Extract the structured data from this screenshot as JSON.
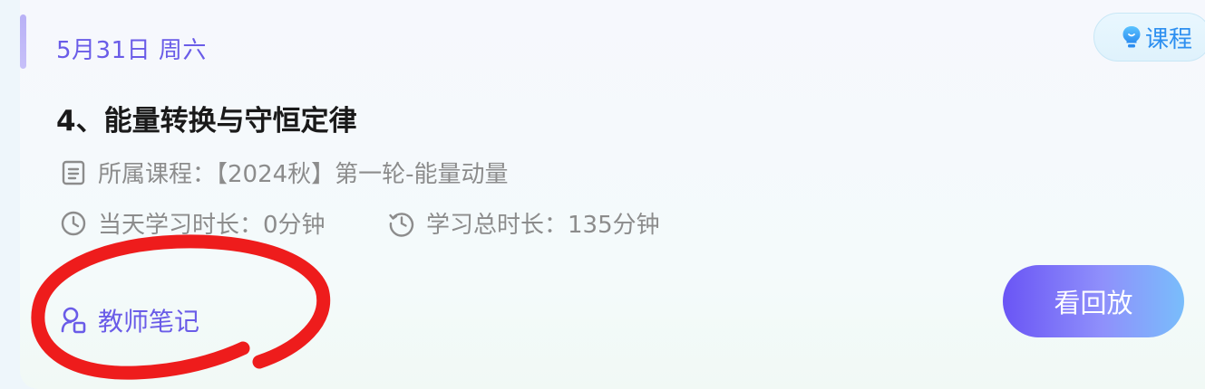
{
  "card": {
    "date": "5月31日 周六",
    "tag": {
      "label": "课程",
      "icon": "lightbulb-icon"
    },
    "title": "4、能量转换与守恒定律",
    "course": {
      "icon": "document-icon",
      "text": "所属课程：【2024秋】第一轮-能量动量"
    },
    "today_duration": {
      "icon": "clock-icon",
      "text": "当天学习时长：0分钟"
    },
    "total_duration": {
      "icon": "history-clock-icon",
      "text": "学习总时长：135分钟"
    },
    "teacher_notes": {
      "icon": "teacher-notes-icon",
      "label": "教师笔记"
    },
    "replay_button": {
      "label": "看回放"
    }
  },
  "colors": {
    "accent_purple": "#6a5ce8",
    "tag_blue": "#2d8ff0",
    "annotation_red": "#ee1c1c"
  }
}
